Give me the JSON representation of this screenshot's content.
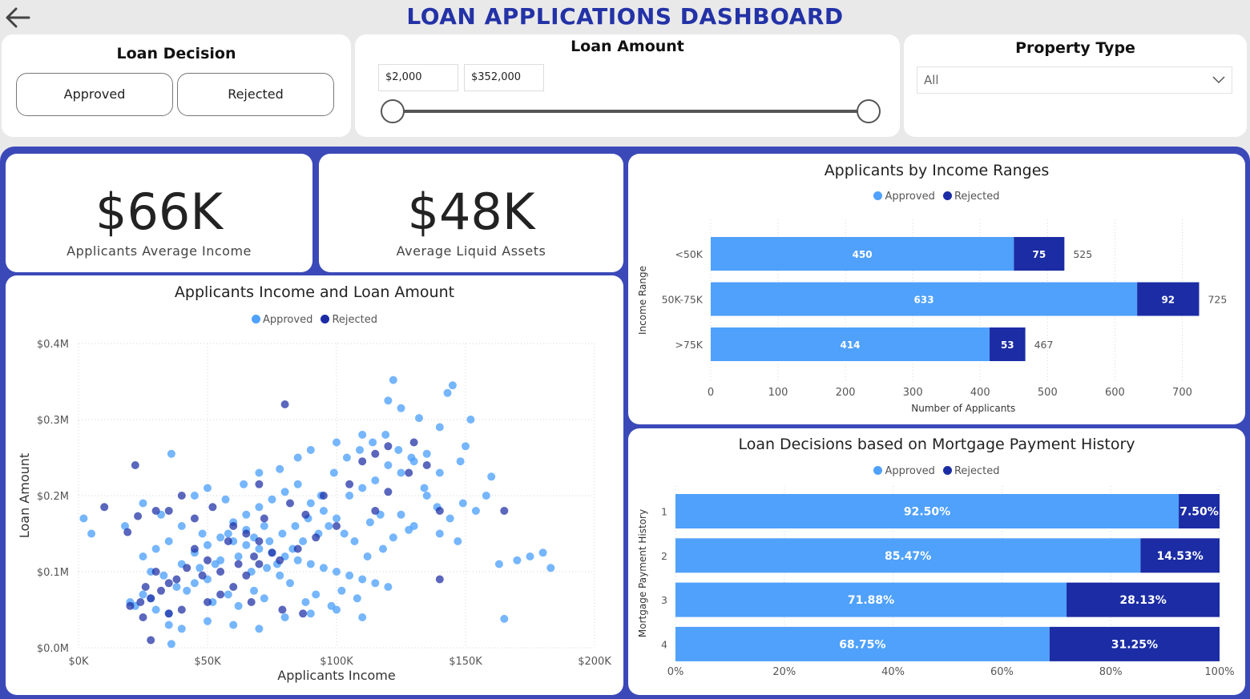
{
  "header": {
    "title": "LOAN APPLICATIONS DASHBOARD",
    "back_icon": "arrow-left-icon"
  },
  "filters": {
    "loan_decision": {
      "title": "Loan Decision",
      "options": [
        "Approved",
        "Rejected"
      ]
    },
    "loan_amount": {
      "title": "Loan Amount",
      "min_value": "$2,000",
      "max_value": "$352,000",
      "range_fraction": [
        0,
        1
      ]
    },
    "property_type": {
      "title": "Property Type",
      "selected": "All",
      "icon": "chevron-down-icon"
    }
  },
  "kpis": [
    {
      "value": "$66K",
      "label": "Applicants Average Income"
    },
    {
      "value": "$48K",
      "label": "Average Liquid Assets"
    }
  ],
  "colors": {
    "approved": "#4fa1fb",
    "rejected": "#1b2ca4",
    "frame": "#3b49b8",
    "title": "#2332a6"
  },
  "chart_data": [
    {
      "type": "scatter",
      "title": "Applicants Income and Loan Amount",
      "xlabel": "Applicants Income",
      "ylabel": "Loan Amount",
      "legend": [
        "Approved",
        "Rejected"
      ],
      "legend_position": "top-center",
      "xlim": [
        0,
        200000
      ],
      "ylim": [
        0,
        400000
      ],
      "x_ticks": [
        "$0K",
        "$50K",
        "$100K",
        "$150K",
        "$200K"
      ],
      "y_ticks": [
        "$0.0M",
        "$0.1M",
        "$0.2M",
        "$0.3M",
        "$0.4M"
      ],
      "grid": true,
      "series": [
        {
          "name": "Approved",
          "points": [
            [
              122000,
              352000
            ],
            [
              145000,
              345000
            ],
            [
              143000,
              335000
            ],
            [
              120000,
              325000
            ],
            [
              125000,
              315000
            ],
            [
              152000,
              300000
            ],
            [
              132000,
              302000
            ],
            [
              140000,
              290000
            ],
            [
              36000,
              255000
            ],
            [
              110000,
              280000
            ],
            [
              100000,
              270000
            ],
            [
              90000,
              260000
            ],
            [
              85000,
              250000
            ],
            [
              78000,
              235000
            ],
            [
              70000,
              230000
            ],
            [
              160000,
              225000
            ],
            [
              148000,
              245000
            ],
            [
              150000,
              265000
            ],
            [
              158000,
              200000
            ],
            [
              135000,
              200000
            ],
            [
              2000,
              170000
            ],
            [
              18000,
              160000
            ],
            [
              5000,
              150000
            ],
            [
              25000,
              190000
            ],
            [
              32000,
              175000
            ],
            [
              40000,
              160000
            ],
            [
              48000,
              150000
            ],
            [
              55000,
              145000
            ],
            [
              60000,
              140000
            ],
            [
              65000,
              135000
            ],
            [
              70000,
              130000
            ],
            [
              75000,
              125000
            ],
            [
              80000,
              120000
            ],
            [
              85000,
              115000
            ],
            [
              90000,
              110000
            ],
            [
              95000,
              105000
            ],
            [
              100000,
              100000
            ],
            [
              105000,
              95000
            ],
            [
              110000,
              90000
            ],
            [
              115000,
              85000
            ],
            [
              120000,
              80000
            ],
            [
              125000,
              175000
            ],
            [
              130000,
              160000
            ],
            [
              140000,
              150000
            ],
            [
              147000,
              140000
            ],
            [
              163000,
              110000
            ],
            [
              175000,
              120000
            ],
            [
              180000,
              125000
            ],
            [
              183000,
              105000
            ],
            [
              170000,
              115000
            ],
            [
              165000,
              38000
            ],
            [
              20000,
              60000
            ],
            [
              22000,
              55000
            ],
            [
              25000,
              70000
            ],
            [
              28000,
              65000
            ],
            [
              30000,
              50000
            ],
            [
              35000,
              45000
            ],
            [
              38000,
              80000
            ],
            [
              42000,
              75000
            ],
            [
              45000,
              85000
            ],
            [
              50000,
              90000
            ],
            [
              52000,
              60000
            ],
            [
              58000,
              70000
            ],
            [
              62000,
              55000
            ],
            [
              68000,
              75000
            ],
            [
              72000,
              65000
            ],
            [
              78000,
              95000
            ],
            [
              82000,
              85000
            ],
            [
              88000,
              60000
            ],
            [
              92000,
              70000
            ],
            [
              98000,
              55000
            ],
            [
              102000,
              75000
            ],
            [
              108000,
              65000
            ],
            [
              112000,
              120000
            ],
            [
              118000,
              130000
            ],
            [
              122000,
              145000
            ],
            [
              128000,
              155000
            ],
            [
              25000,
              120000
            ],
            [
              30000,
              130000
            ],
            [
              35000,
              140000
            ],
            [
              40000,
              110000
            ],
            [
              45000,
              125000
            ],
            [
              50000,
              135000
            ],
            [
              55000,
              115000
            ],
            [
              60000,
              165000
            ],
            [
              65000,
              175000
            ],
            [
              70000,
              185000
            ],
            [
              75000,
              195000
            ],
            [
              80000,
              205000
            ],
            [
              85000,
              215000
            ],
            [
              90000,
              190000
            ],
            [
              95000,
              180000
            ],
            [
              100000,
              170000
            ],
            [
              105000,
              200000
            ],
            [
              110000,
              210000
            ],
            [
              115000,
              220000
            ],
            [
              120000,
              240000
            ],
            [
              125000,
              230000
            ],
            [
              130000,
              245000
            ],
            [
              135000,
              255000
            ],
            [
              140000,
              230000
            ],
            [
              57000,
              195000
            ],
            [
              50000,
              210000
            ],
            [
              45000,
              200000
            ],
            [
              64000,
              215000
            ],
            [
              28000,
              100000
            ],
            [
              33000,
              95000
            ],
            [
              47000,
              105000
            ],
            [
              53000,
              110000
            ],
            [
              67000,
              100000
            ],
            [
              73000,
              105000
            ],
            [
              77000,
              110000
            ],
            [
              83000,
              130000
            ],
            [
              87000,
              140000
            ],
            [
              93000,
              150000
            ],
            [
              97000,
              160000
            ],
            [
              103000,
              150000
            ],
            [
              107000,
              140000
            ],
            [
              113000,
              165000
            ],
            [
              117000,
              175000
            ],
            [
              35000,
              30000
            ],
            [
              40000,
              25000
            ],
            [
              50000,
              35000
            ],
            [
              60000,
              30000
            ],
            [
              70000,
              25000
            ],
            [
              80000,
              40000
            ],
            [
              90000,
              45000
            ],
            [
              100000,
              50000
            ],
            [
              110000,
              40000
            ],
            [
              36000,
              5000
            ],
            [
              65000,
              155000
            ],
            [
              72000,
              160000
            ],
            [
              58000,
              150000
            ],
            [
              62000,
              120000
            ],
            [
              68000,
              145000
            ],
            [
              74000,
              140000
            ],
            [
              79000,
              150000
            ],
            [
              84000,
              160000
            ],
            [
              89000,
              170000
            ],
            [
              94000,
              200000
            ],
            [
              99000,
              230000
            ],
            [
              104000,
              250000
            ],
            [
              109000,
              260000
            ],
            [
              114000,
              270000
            ],
            [
              119000,
              280000
            ],
            [
              124000,
              260000
            ],
            [
              129000,
              250000
            ],
            [
              134000,
              210000
            ],
            [
              139000,
              185000
            ],
            [
              144000,
              170000
            ],
            [
              149000,
              190000
            ],
            [
              154000,
              180000
            ]
          ]
        },
        {
          "name": "Rejected",
          "points": [
            [
              80000,
              320000
            ],
            [
              22000,
              240000
            ],
            [
              10000,
              185000
            ],
            [
              40000,
              200000
            ],
            [
              35000,
              180000
            ],
            [
              52000,
              185000
            ],
            [
              45000,
              170000
            ],
            [
              60000,
              160000
            ],
            [
              65000,
              150000
            ],
            [
              70000,
              140000
            ],
            [
              75000,
              125000
            ],
            [
              68000,
              120000
            ],
            [
              62000,
              110000
            ],
            [
              55000,
              100000
            ],
            [
              50000,
              115000
            ],
            [
              48000,
              95000
            ],
            [
              42000,
              105000
            ],
            [
              38000,
              90000
            ],
            [
              35000,
              85000
            ],
            [
              32000,
              75000
            ],
            [
              28000,
              65000
            ],
            [
              24000,
              60000
            ],
            [
              20000,
              55000
            ],
            [
              30000,
              100000
            ],
            [
              26000,
              80000
            ],
            [
              45000,
              130000
            ],
            [
              58000,
              140000
            ],
            [
              72000,
              170000
            ],
            [
              82000,
              190000
            ],
            [
              88000,
              175000
            ],
            [
              95000,
              200000
            ],
            [
              105000,
              215000
            ],
            [
              110000,
              245000
            ],
            [
              115000,
              255000
            ],
            [
              120000,
              265000
            ],
            [
              130000,
              270000
            ],
            [
              135000,
              240000
            ],
            [
              128000,
              230000
            ],
            [
              115000,
              180000
            ],
            [
              100000,
              160000
            ],
            [
              92000,
              145000
            ],
            [
              85000,
              130000
            ],
            [
              78000,
              115000
            ],
            [
              70000,
              110000
            ],
            [
              65000,
              95000
            ],
            [
              60000,
              80000
            ],
            [
              55000,
              70000
            ],
            [
              50000,
              60000
            ],
            [
              40000,
              50000
            ],
            [
              35000,
              45000
            ],
            [
              25000,
              40000
            ],
            [
              28000,
              10000
            ],
            [
              70000,
              215000
            ],
            [
              67000,
              60000
            ],
            [
              79000,
              50000
            ],
            [
              87000,
              45000
            ],
            [
              120000,
              205000
            ],
            [
              140000,
              180000
            ],
            [
              165000,
              180000
            ],
            [
              140000,
              90000
            ],
            [
              30000,
              180000
            ],
            [
              23000,
              173000
            ],
            [
              19000,
              152000
            ]
          ]
        }
      ]
    },
    {
      "type": "bar",
      "orientation": "horizontal",
      "stacked": true,
      "title": "Applicants by Income Ranges",
      "xlabel": "Number of Applicants",
      "ylabel": "Income Range",
      "legend": [
        "Approved",
        "Rejected"
      ],
      "legend_position": "top-center",
      "categories": [
        "<50K",
        "50K-75K",
        ">75K"
      ],
      "series": [
        {
          "name": "Approved",
          "values": [
            450,
            633,
            414
          ]
        },
        {
          "name": "Rejected",
          "values": [
            75,
            92,
            53
          ]
        }
      ],
      "totals": [
        525,
        725,
        467
      ],
      "xlim": [
        0,
        750
      ],
      "x_ticks": [
        "0",
        "100",
        "200",
        "300",
        "400",
        "500",
        "600",
        "700"
      ],
      "grid": true
    },
    {
      "type": "bar",
      "orientation": "horizontal",
      "stacked": true,
      "percent": true,
      "title": "Loan Decisions based on Mortgage Payment History",
      "ylabel": "Mortgage Payment History",
      "legend": [
        "Approved",
        "Rejected"
      ],
      "legend_position": "top-center",
      "categories": [
        "1",
        "2",
        "3",
        "4"
      ],
      "series": [
        {
          "name": "Approved",
          "values": [
            92.5,
            85.47,
            71.88,
            68.75
          ],
          "labels": [
            "92.50%",
            "85.47%",
            "71.88%",
            "68.75%"
          ]
        },
        {
          "name": "Rejected",
          "values": [
            7.5,
            14.53,
            28.13,
            31.25
          ],
          "labels": [
            "7.50%",
            "14.53%",
            "28.13%",
            "31.25%"
          ]
        }
      ],
      "xlim": [
        0,
        100
      ],
      "x_ticks": [
        "0%",
        "20%",
        "40%",
        "60%",
        "80%",
        "100%"
      ],
      "grid": true
    }
  ]
}
